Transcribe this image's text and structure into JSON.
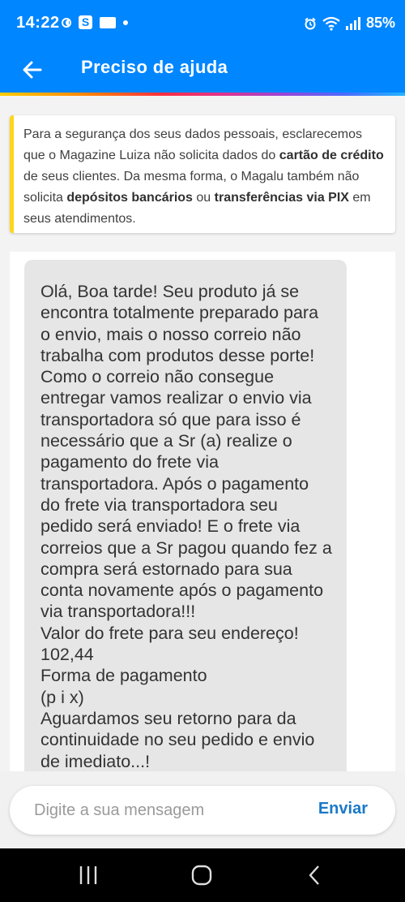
{
  "status_bar": {
    "time": "14:22",
    "battery": "85%",
    "left_icons": [
      "do-not-disturb-icon",
      "app-s-icon",
      "app-notification-icon",
      "more-notifications-dot"
    ],
    "right_icons": [
      "alarm-icon",
      "wifi-icon",
      "signal-icon"
    ]
  },
  "appbar": {
    "title": "Preciso de ajuda",
    "back_icon": "arrow-left-icon",
    "color": "#0086ff"
  },
  "notice": {
    "t1": "Para a segurança dos seus dados pessoais, esclarecemos que o Magazine Luiza não solicita dados do ",
    "b1": "cartão de crédito",
    "t2": " de seus clientes. Da mesma forma, o Magalu também não solicita ",
    "b2": "depósitos bancários",
    "t3": " ou ",
    "b3": "transferências via PIX",
    "t4": " em seus atendimentos.",
    "accent_color": "#ffd51c"
  },
  "chat": {
    "message": "Olá, Boa tarde! Seu produto já se encontra totalmente preparado para o envio, mais o nosso correio não trabalha com produtos desse porte! Como o correio não consegue entregar vamos realizar o envio via transportadora só que para isso é necessário que a Sr (a) realize o pagamento do frete via transportadora. Após o pagamento do frete via transportadora seu pedido será enviado! E o frete via correios que a Sr pagou quando fez a compra será estornado para sua conta novamente após o pagamento via transportadora!!!\nValor do frete para seu endereço!\n102,44\nForma de pagamento\n(p i x)\nAguardamos seu retorno para da continuidade no seu pedido e envio de imediato...!"
  },
  "composer": {
    "placeholder": "Digite a sua mensagem",
    "send_label": "Enviar"
  },
  "nav": {
    "icons": [
      "recent-apps-icon",
      "home-icon",
      "back-icon"
    ]
  }
}
